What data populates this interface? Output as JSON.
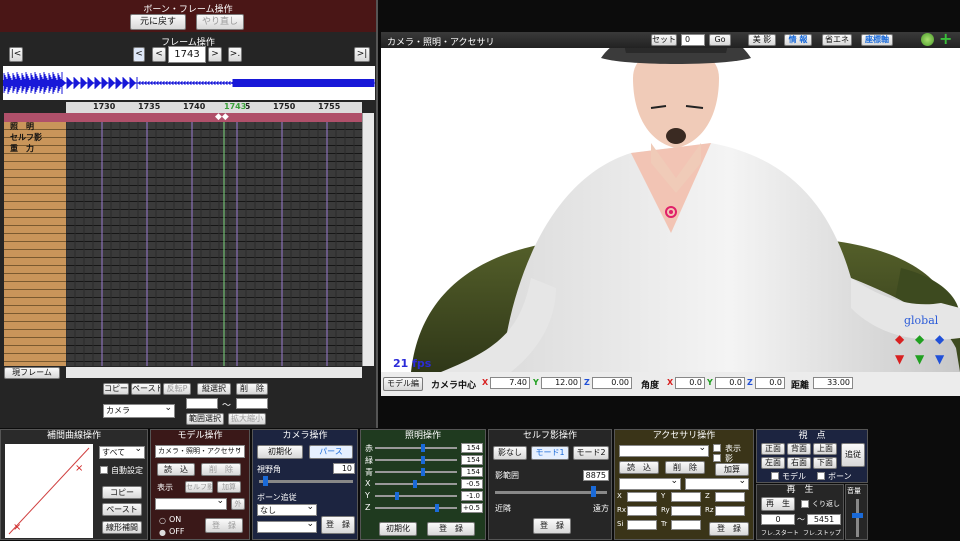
{
  "bone_frame": {
    "title": "ボーン・フレーム操作",
    "undo_label": "元に戻す",
    "redo_label": "やり直し"
  },
  "frame_op": {
    "title": "フレーム操作",
    "first_btn": "|<",
    "prev_key_btn": "<",
    "prev_btn": "<",
    "frame_value": "1743",
    "next_btn": ">",
    "next_key_btn": ">.",
    "last_btn": ">|"
  },
  "timeline": {
    "ruler_ticks": [
      "1730",
      "1735",
      "1740",
      "1745",
      "1750",
      "1755"
    ],
    "current_frame_label": "1743",
    "tracks": [
      "照　明",
      "セルフ影",
      "重　力"
    ],
    "current_frame_btn": "現フレーム"
  },
  "timeline_actions": {
    "copy": "コピー",
    "paste": "ペースト",
    "reverse_paste": "反転P",
    "vertical_select": "縦選択",
    "delete": "削　除",
    "target_select": "カメラ",
    "range_sep": "〜",
    "range_select": "範囲選択",
    "zoom": "拡大縮小"
  },
  "viewport": {
    "title": "カメラ・照明・アクセサリ",
    "set_label": "セット",
    "set_value": "0",
    "go_label": "Go",
    "shadow_btn": "美 影",
    "info_btn": "情 報",
    "eco_btn": "省エネ",
    "axis_btn": "座標軸",
    "fps": "21 fps",
    "global_label": "global"
  },
  "camera_bar": {
    "model_tab": "モデル編",
    "center_label": "カメラ中心",
    "cx": "7.40",
    "cy": "12.00",
    "cz": "0.00",
    "angle_label": "角度",
    "ax": "0.0",
    "ay": "0.0",
    "az": "0.0",
    "dist_label": "距離",
    "dist": "33.00",
    "x": "X",
    "y": "Y",
    "z": "Z"
  },
  "interp": {
    "title": "補間曲線操作",
    "all_select": "すべて",
    "auto_label": "自動設定",
    "copy": "コピー",
    "paste": "ペースト",
    "linear": "線形補間"
  },
  "model_op": {
    "title": "モデル操作",
    "target": "カメラ・照明・アクセサリ",
    "load": "読　込",
    "delete": "削　除",
    "show_label": "表示",
    "self_shadow": "セルフ影",
    "add": "加算",
    "out": "外",
    "on": "ON",
    "off": "OFF",
    "register": "登　録"
  },
  "camera_op": {
    "title": "カメラ操作",
    "init": "初期化",
    "perspective": "パース",
    "fov_label": "視野角",
    "fov": "10",
    "bone_follow_label": "ボーン追従",
    "follow_select": "なし",
    "register": "登　録"
  },
  "light_op": {
    "title": "照明操作",
    "r_label": "赤",
    "g_label": "緑",
    "b_label": "青",
    "r": "154",
    "g": "154",
    "b": "154",
    "x_label": "X",
    "y_label": "Y",
    "z_label": "Z",
    "x": "-0.5",
    "y": "-1.0",
    "z": "+0.5",
    "init": "初期化",
    "register": "登　録"
  },
  "self_shadow_op": {
    "title": "セルフ影操作",
    "none": "影なし",
    "mode1": "モード1",
    "mode2": "モード2",
    "range_label": "影範囲",
    "range": "8875",
    "near": "近隣",
    "far": "遠方",
    "register": "登　録"
  },
  "accessory_op": {
    "title": "アクセサリ操作",
    "show_label": "表示",
    "shadow_label": "影",
    "load": "読　込",
    "delete": "削　除",
    "add": "加算",
    "x": "X",
    "y": "Y",
    "z": "Z",
    "rx": "Rx",
    "ry": "Ry",
    "rz": "Rz",
    "si": "Si",
    "tr": "Tr",
    "register": "登　録"
  },
  "view_op": {
    "title": "視　点",
    "front": "正面",
    "back": "背面",
    "top": "上面",
    "follow": "追従",
    "left": "左面",
    "right": "右面",
    "bottom": "下面",
    "model": "モデル",
    "bone": "ボーン"
  },
  "playback": {
    "title": "再　生",
    "play": "再　生",
    "repeat": "くり返し",
    "start": "0",
    "sep": "〜",
    "end": "5451",
    "frame_start": "フレ.スタート",
    "frame_stop": "フレ.ストップ",
    "volume_title": "音量"
  },
  "colors": {
    "panel_title_red": "#5a1a1a",
    "wave_blue": "#1818d8",
    "timeline_track": "#c9955a",
    "ruler_pink": "#b0506a",
    "light_panel_green": "#1f3a1f",
    "accent_blue": "#1a6ad8"
  }
}
